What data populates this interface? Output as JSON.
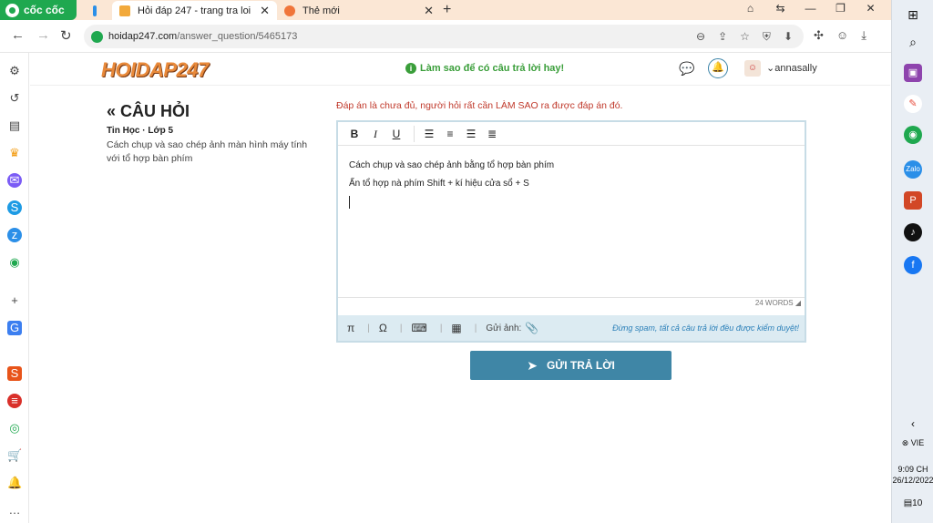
{
  "browser": {
    "brand": "cốc cốc",
    "tabs": [
      {
        "title": "",
        "favicon": "zalo-icon"
      },
      {
        "title": "Hỏi đáp 247 - trang tra loi",
        "favicon": "hoidap-icon",
        "active": true
      },
      {
        "title": "Thẻ mới",
        "favicon": "coccoc-icon"
      }
    ],
    "url_host": "hoidap247.com",
    "url_path": "/answer_question/5465173"
  },
  "header": {
    "logo": "HOIDAP247",
    "tip": "Làm sao để có câu trả lời hay!",
    "username": "annasally"
  },
  "question": {
    "heading": "CÂU HỎI",
    "subject": "Tin Học · Lớp 5",
    "text": "Cách chụp và sao chép ảnh màn hình máy tính với tổ hợp bàn phím"
  },
  "answer": {
    "warning": "Đáp án là chưa đủ, người hỏi rất cần LÀM SAO ra được đáp án đó.",
    "line1": "Cách chụp và sao chép ảnh bằng tổ hợp bàn phím",
    "line2": "Ấn tổ hợp nà phím Shift + kí hiệu cửa sổ + S",
    "word_count": "24 WORDS",
    "toolbar": [
      "B",
      "I",
      "U"
    ],
    "attach_label": "Gửi ảnh:",
    "note": "Đừng spam, tất cả câu trả lời đều được kiểm duyệt!",
    "send_label": "GỬI TRẢ LỜI"
  },
  "tray": {
    "lang": "VIE",
    "time": "9:09 CH",
    "date": "26/12/2022",
    "notif": "10"
  },
  "colors": {
    "accent": "#3f86a6",
    "warning": "#c0392b",
    "success": "#3a9e3a",
    "brand": "#1fa84f"
  }
}
